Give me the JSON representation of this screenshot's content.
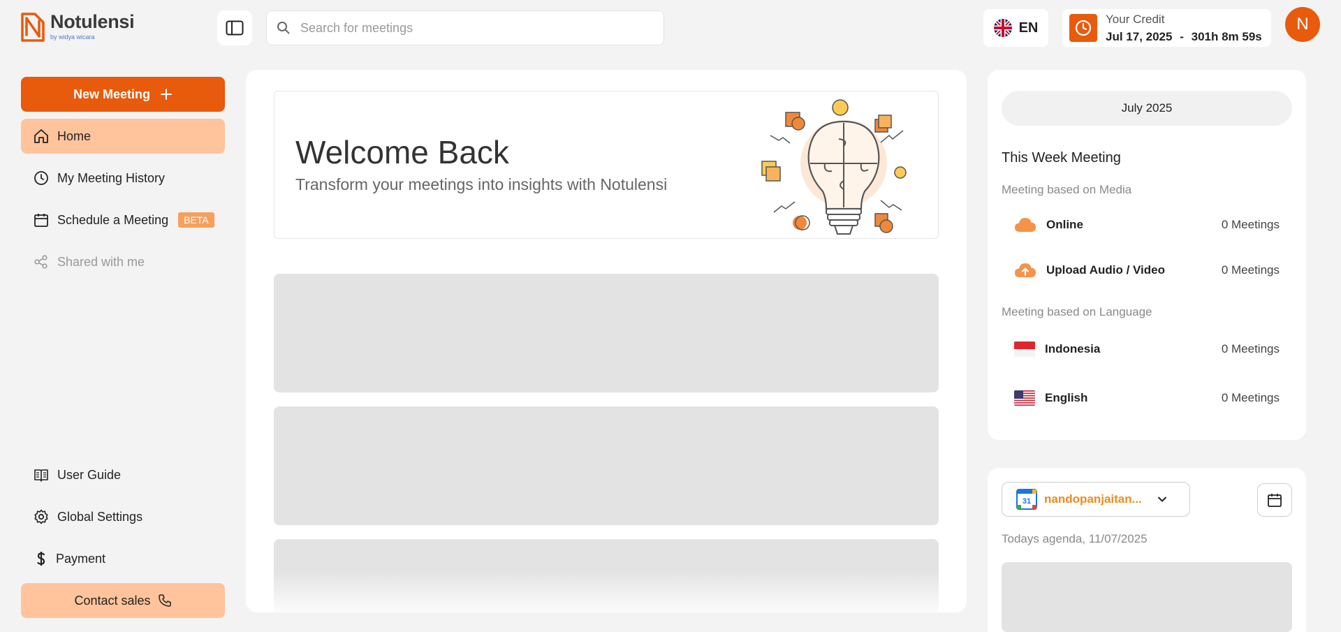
{
  "brand": {
    "name": "Notulensi",
    "byline": "by widya wicara"
  },
  "search": {
    "placeholder": "Search for meetings"
  },
  "language": {
    "code": "EN"
  },
  "credit": {
    "title": "Your Credit",
    "date": "Jul 17, 2025",
    "separator": "-",
    "remaining": "301h 8m 59s"
  },
  "user": {
    "initial": "N"
  },
  "sidebar": {
    "new_meeting": "New Meeting",
    "items": [
      {
        "label": "Home"
      },
      {
        "label": "My Meeting History"
      },
      {
        "label": "Schedule a Meeting",
        "badge": "BETA"
      },
      {
        "label": "Shared with me"
      }
    ],
    "bottom": [
      {
        "label": "User Guide"
      },
      {
        "label": "Global Settings"
      },
      {
        "label": "Payment"
      }
    ],
    "contact": "Contact sales"
  },
  "welcome": {
    "title": "Welcome Back",
    "subtitle": "Transform your meetings into insights with Notulensi"
  },
  "summary": {
    "month": "July 2025",
    "week_title": "This Week Meeting",
    "media_label": "Meeting based on Media",
    "media": [
      {
        "name": "Online",
        "count": "0 Meetings"
      },
      {
        "name": "Upload Audio / Video",
        "count": "0 Meetings"
      }
    ],
    "language_label": "Meeting based on Language",
    "languages": [
      {
        "name": "Indonesia",
        "count": "0 Meetings"
      },
      {
        "name": "English",
        "count": "0 Meetings"
      }
    ]
  },
  "calendar": {
    "account": "nandopanjaitan...",
    "agenda_label": "Todays agenda, 11/07/2025"
  },
  "colors": {
    "accent": "#e85a0c",
    "accent_light": "#ffc49b",
    "badge": "#f6a05c"
  }
}
